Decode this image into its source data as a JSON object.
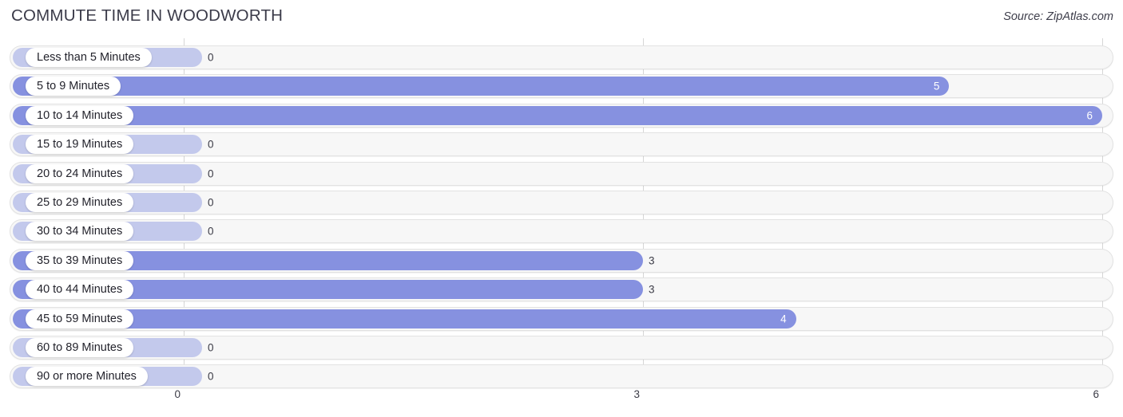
{
  "header": {
    "title": "COMMUTE TIME IN WOODWORTH",
    "source": "Source: ZipAtlas.com"
  },
  "colors": {
    "bar_fill": "#8691e0",
    "bar_zero": "#c3c9ec",
    "track_bg": "#f7f7f7",
    "track_border": "#e2e2e2",
    "gridline": "#d6d6d6",
    "label_text": "#23232c",
    "value_text_inside": "#ffffff",
    "value_text_outside": "#3b3b46"
  },
  "chart_data": {
    "type": "bar",
    "orientation": "horizontal",
    "title": "COMMUTE TIME IN WOODWORTH",
    "xlabel": "",
    "ylabel": "",
    "xlim": [
      0,
      6
    ],
    "grid": true,
    "legend": false,
    "xticks": [
      "0",
      "3",
      "6"
    ],
    "xtick_values": [
      0,
      3,
      6
    ],
    "categories": [
      "Less than 5 Minutes",
      "5 to 9 Minutes",
      "10 to 14 Minutes",
      "15 to 19 Minutes",
      "20 to 24 Minutes",
      "25 to 29 Minutes",
      "30 to 34 Minutes",
      "35 to 39 Minutes",
      "40 to 44 Minutes",
      "45 to 59 Minutes",
      "60 to 89 Minutes",
      "90 or more Minutes"
    ],
    "values": [
      0,
      5,
      6,
      0,
      0,
      0,
      0,
      3,
      3,
      4,
      0,
      0
    ],
    "value_labels": [
      "0",
      "5",
      "6",
      "0",
      "0",
      "0",
      "0",
      "3",
      "3",
      "4",
      "0",
      "0"
    ]
  }
}
